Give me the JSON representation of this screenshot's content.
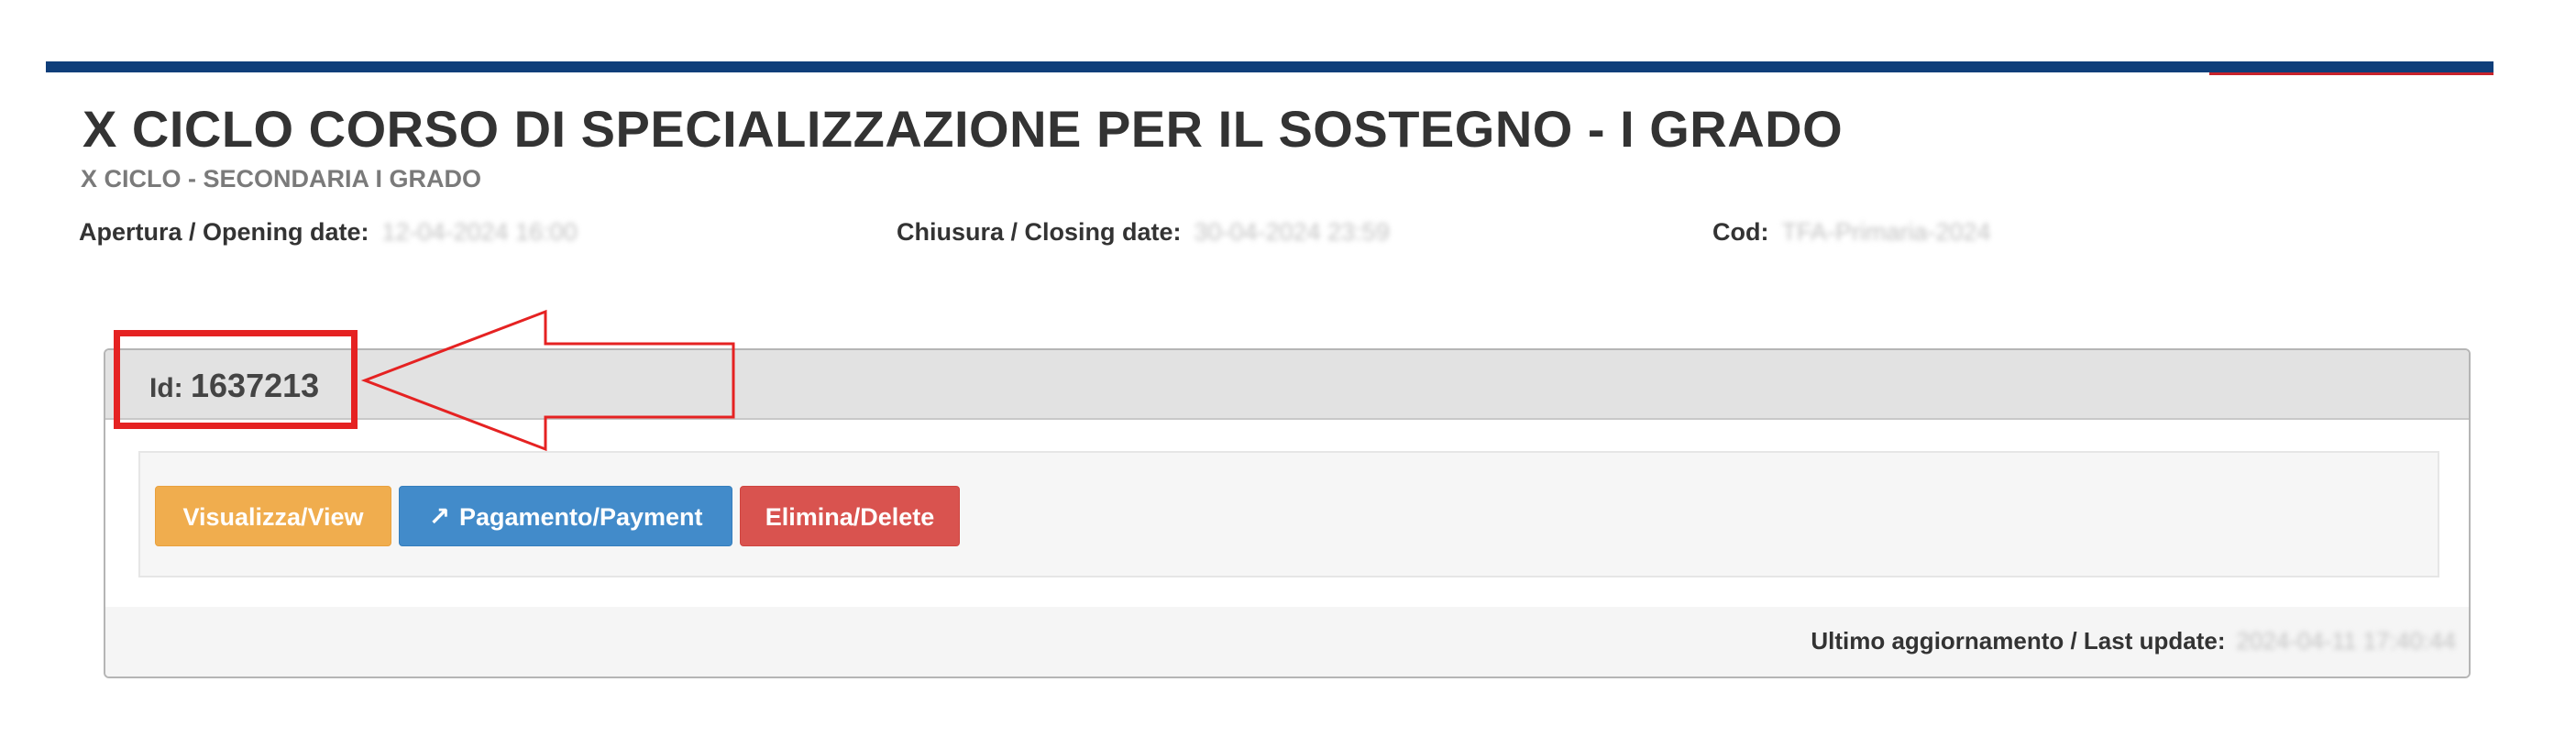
{
  "page": {
    "title": "X CICLO CORSO DI SPECIALIZZAZIONE PER IL SOSTEGNO - I GRADO",
    "subtitle": "X CICLO - SECONDARIA I GRADO",
    "colors": {
      "top_bar": "#0f3e7a",
      "top_bar_accent": "#c8232b",
      "annotation": "#e52222"
    }
  },
  "meta": {
    "opening_label": "Apertura / Opening date:",
    "opening_value": "12-04-2024 16:00",
    "closing_label": "Chiusura / Closing date:",
    "closing_value": "30-04-2024 23:59",
    "code_label": "Cod:",
    "code_value": "TFA-Primaria-2024"
  },
  "panel": {
    "id_label": "Id:",
    "id_value": "1637213",
    "buttons": {
      "view": "Visualizza/View",
      "payment": "Pagamento/Payment",
      "payment_icon": "external-link-icon",
      "delete": "Elimina/Delete"
    },
    "button_colors": {
      "view": "#f0ad4e",
      "payment": "#428bca",
      "delete": "#d9534f"
    },
    "last_update_label": "Ultimo aggiornamento / Last update:",
    "last_update_value": "2024-04-11 17:40:44"
  }
}
